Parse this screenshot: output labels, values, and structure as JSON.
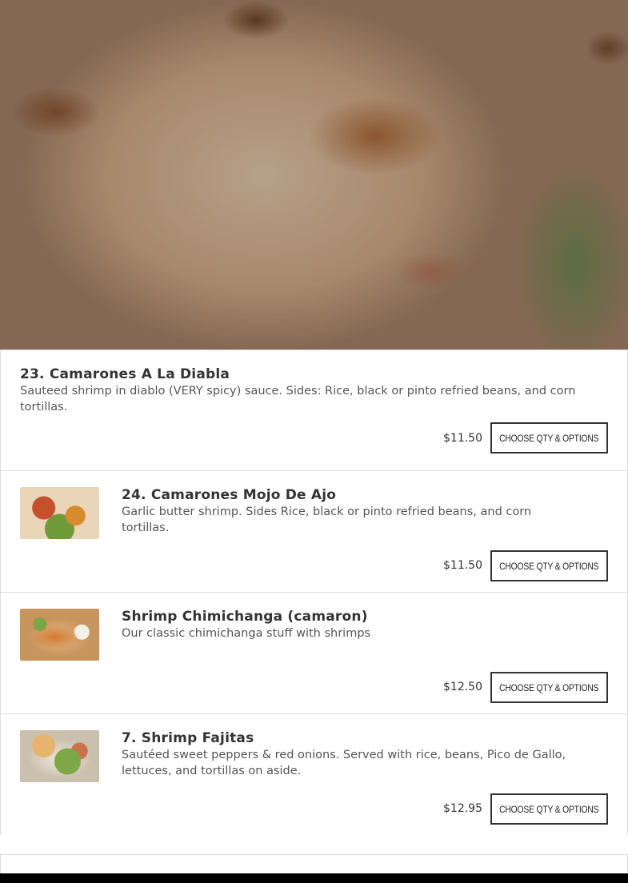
{
  "items": [
    {
      "title": "23. Camarones A La Diabla",
      "description": "Sauteed shrimp in diablo (VERY spicy) sauce. Sides: Rice, black or pinto refried beans, and corn tortillas.",
      "price": "$11.50",
      "button": "CHOOSE QTY & OPTIONS"
    },
    {
      "title": "24. Camarones Mojo De Ajo",
      "description": "Garlic butter shrimp. Sides Rice, black or pinto refried beans, and corn tortillas.",
      "price": "$11.50",
      "button": "CHOOSE QTY & OPTIONS"
    },
    {
      "title": "Shrimp Chimichanga (camaron)",
      "description": "Our classic chimichanga stuff with shrimps",
      "price": "$12.50",
      "button": "CHOOSE QTY & OPTIONS"
    },
    {
      "title": "7. Shrimp Fajitas",
      "description": "Sautéed sweet peppers & red onions. Served with rice, beans, Pico de Gallo, lettuces, and tortillas on aside.",
      "price": "$12.95",
      "button": "CHOOSE QTY & OPTIONS"
    }
  ]
}
